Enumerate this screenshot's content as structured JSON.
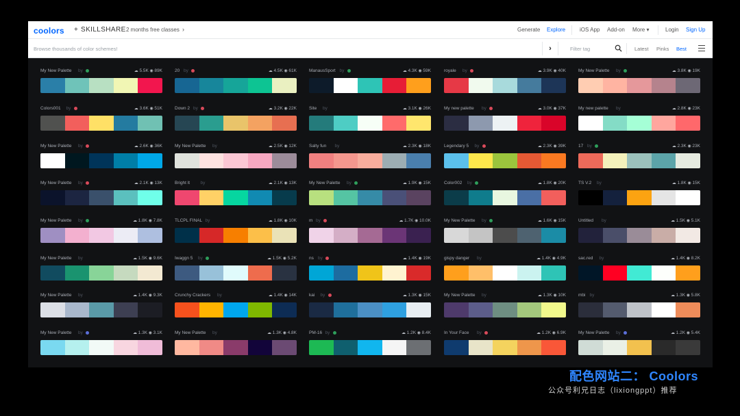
{
  "header": {
    "logo": "coolors",
    "plus": "+",
    "partner": "SKILLSHARE",
    "promo": "2 months free classes",
    "promo_arrow": "›",
    "nav": [
      "Generate",
      "Explore",
      "iOS App",
      "Add-on",
      "More ▾",
      "Login",
      "Sign Up"
    ],
    "active_nav": "Explore"
  },
  "subheader": {
    "browse_placeholder": "Browse thousands of color schemes!",
    "next_arrow": "›",
    "filter_placeholder": "Filter tag",
    "sort": [
      "Latest",
      "Pinks",
      "Best"
    ],
    "active_sort": "Best"
  },
  "palettes": [
    {
      "name": "My New Palette",
      "by": "by",
      "dot": "#2e9e5b",
      "downloads": "5.5K",
      "views": "89K",
      "colors": [
        "#2a7fa8",
        "#6fc3b9",
        "#b8e0c2",
        "#f1f6b4",
        "#f2164e"
      ]
    },
    {
      "name": "20",
      "by": "by",
      "dot": "#d94a5a",
      "downloads": "4.5K",
      "views": "61K",
      "colors": [
        "#176693",
        "#17869b",
        "#16a599",
        "#0dc493",
        "#eaf0c1"
      ]
    },
    {
      "name": "ManausSport",
      "by": "by",
      "dot": "#2e9e5b",
      "downloads": "4.3K",
      "views": "59K",
      "colors": [
        "#0d1b2a",
        "#ffffff",
        "#2ec4b6",
        "#e71d36",
        "#ff9f1c"
      ]
    },
    {
      "name": "royale",
      "by": "by",
      "dot": "#d94a5a",
      "downloads": "3.9K",
      "views": "40K",
      "colors": [
        "#e63946",
        "#f1faee",
        "#a8dadc",
        "#457b9d",
        "#1d3557"
      ]
    },
    {
      "name": "My New Palette",
      "by": "by",
      "dot": "#2e9e5b",
      "downloads": "3.8K",
      "views": "19K",
      "colors": [
        "#ffcdb2",
        "#ffb4a2",
        "#e5989b",
        "#b5838d",
        "#6d6875"
      ]
    },
    {
      "name": "Colors001",
      "by": "by",
      "dot": "#d94a5a",
      "downloads": "3.6K",
      "views": "51K",
      "colors": [
        "#50514f",
        "#f25f5c",
        "#ffe066",
        "#247ba0",
        "#70c1b3"
      ]
    },
    {
      "name": "Down 2",
      "by": "by",
      "dot": "#d94a5a",
      "downloads": "3.2K",
      "views": "22K",
      "colors": [
        "#264653",
        "#2a9d8f",
        "#e9c46a",
        "#f4a261",
        "#e76f51"
      ]
    },
    {
      "name": "Site",
      "by": "by",
      "dot": "",
      "downloads": "3.1K",
      "views": "26K",
      "colors": [
        "#247b7b",
        "#4ecdc4",
        "#f7fff7",
        "#ff6b6b",
        "#ffe66d"
      ]
    },
    {
      "name": "My new palette",
      "by": "by",
      "dot": "#d94a5a",
      "downloads": "3.0K",
      "views": "37K",
      "colors": [
        "#2b2d42",
        "#8d99ae",
        "#edf2f4",
        "#ef233c",
        "#d90429"
      ]
    },
    {
      "name": "My new palette",
      "by": "by",
      "dot": "",
      "downloads": "2.8K",
      "views": "23K",
      "colors": [
        "#ffffff",
        "#84dcc6",
        "#a5ffd6",
        "#ffa69e",
        "#ff686b"
      ]
    },
    {
      "name": "My New Palette",
      "by": "by",
      "dot": "#d94a5a",
      "downloads": "2.6K",
      "views": "36K",
      "colors": [
        "#ffffff",
        "#00171f",
        "#003459",
        "#007ea7",
        "#00a8e8"
      ]
    },
    {
      "name": "My New Palette",
      "by": "by",
      "dot": "",
      "downloads": "2.5K",
      "views": "12K",
      "colors": [
        "#dfe2dc",
        "#fde2e0",
        "#fbc7d4",
        "#f7a8c1",
        "#9c8c9a"
      ]
    },
    {
      "name": "Salty fun",
      "by": "by",
      "dot": "",
      "downloads": "2.3K",
      "views": "18K",
      "colors": [
        "#f08080",
        "#f4978e",
        "#f8ad9d",
        "#9cadb3",
        "#4a7fad"
      ]
    },
    {
      "name": "Legendary 5",
      "by": "by",
      "dot": "#d94a5a",
      "downloads": "2.3K",
      "views": "39K",
      "colors": [
        "#5bc0eb",
        "#fde74c",
        "#9bc53d",
        "#e55934",
        "#fa7921"
      ]
    },
    {
      "name": "17",
      "by": "by",
      "dot": "#2e9e5b",
      "downloads": "2.3K",
      "views": "23K",
      "colors": [
        "#ed6a5a",
        "#f4f1bb",
        "#9bc1bc",
        "#5ca4a9",
        "#e6ebe0"
      ]
    },
    {
      "name": "My New Palette",
      "by": "by",
      "dot": "#d94a5a",
      "downloads": "2.1K",
      "views": "13K",
      "colors": [
        "#0b132b",
        "#1c2541",
        "#3a506b",
        "#5bc0be",
        "#6fffe9"
      ]
    },
    {
      "name": "Bright lt",
      "by": "by",
      "dot": "",
      "downloads": "2.1K",
      "views": "13K",
      "colors": [
        "#ef476f",
        "#ffd166",
        "#06d6a0",
        "#118ab2",
        "#073b4c"
      ]
    },
    {
      "name": "My New Palette",
      "by": "by",
      "dot": "#2e9e5b",
      "downloads": "1.9K",
      "views": "15K",
      "colors": [
        "#b8e07f",
        "#55c4a3",
        "#368ba7",
        "#4a5078",
        "#5a4360"
      ]
    },
    {
      "name": "Color002",
      "by": "by",
      "dot": "#2e9e5b",
      "downloads": "1.8K",
      "views": "20K",
      "colors": [
        "#0b3c49",
        "#0f7c8c",
        "#e8f7e0",
        "#4a6fa5",
        "#f25f5c"
      ]
    },
    {
      "name": "TS V.2",
      "by": "by",
      "dot": "",
      "downloads": "1.8K",
      "views": "15K",
      "colors": [
        "#000000",
        "#14213d",
        "#fca311",
        "#e5e5e5",
        "#ffffff"
      ]
    },
    {
      "name": "My New Palette",
      "by": "by",
      "dot": "#2e9e5b",
      "downloads": "1.8K",
      "views": "7.8K",
      "colors": [
        "#9f8fc2",
        "#f3b0cf",
        "#f2c8e3",
        "#ececf5",
        "#aebfe0"
      ]
    },
    {
      "name": "TLCPL FINAL",
      "by": "by",
      "dot": "",
      "downloads": "1.8K",
      "views": "10K",
      "colors": [
        "#003049",
        "#d62828",
        "#f77f00",
        "#fcbf49",
        "#eae2b7"
      ]
    },
    {
      "name": "m",
      "by": "by",
      "dot": "#d94a5a",
      "downloads": "1.7K",
      "views": "10.0K",
      "colors": [
        "#f0d3e8",
        "#d4aec6",
        "#a56a94",
        "#6b3576",
        "#3a2150"
      ]
    },
    {
      "name": "My New Palette",
      "by": "by",
      "dot": "#2e9e5b",
      "downloads": "1.6K",
      "views": "15K",
      "colors": [
        "#d8d8d8",
        "#c4c4c4",
        "#4c4c4c",
        "#4e6270",
        "#1b8ca6"
      ]
    },
    {
      "name": "Untitled",
      "by": "by",
      "dot": "",
      "downloads": "1.5K",
      "views": "5.1K",
      "colors": [
        "#22223b",
        "#4a4e69",
        "#9a8c98",
        "#c9ada7",
        "#f2e9e4"
      ]
    },
    {
      "name": "My New Palette",
      "by": "by",
      "dot": "",
      "downloads": "1.5K",
      "views": "9.6K",
      "colors": [
        "#114b5f",
        "#1a936f",
        "#88d498",
        "#c6dabf",
        "#f3e9d2"
      ]
    },
    {
      "name": "Iwaggn 5",
      "by": "by",
      "dot": "#2e9e5b",
      "downloads": "1.5K",
      "views": "5.2K",
      "colors": [
        "#3d5a80",
        "#98c1d9",
        "#e0fbfc",
        "#ee6c4d",
        "#293241"
      ]
    },
    {
      "name": "ns",
      "by": "by",
      "dot": "#d94a5a",
      "downloads": "1.4K",
      "views": "19K",
      "colors": [
        "#00a6d6",
        "#1d6ca0",
        "#f0c419",
        "#fff3d0",
        "#d92a2a"
      ]
    },
    {
      "name": "gispy danger",
      "by": "by",
      "dot": "",
      "downloads": "1.4K",
      "views": "4.9K",
      "colors": [
        "#ff9f1c",
        "#ffbf69",
        "#ffffff",
        "#cbf3f0",
        "#2ec4b6"
      ]
    },
    {
      "name": "sac.red",
      "by": "by",
      "dot": "",
      "downloads": "1.4K",
      "views": "8.2K",
      "colors": [
        "#011627",
        "#ff0022",
        "#41ead4",
        "#fdfffc",
        "#ff9f1c"
      ]
    },
    {
      "name": "My New Palette",
      "by": "by",
      "dot": "",
      "downloads": "1.4K",
      "views": "9.3K",
      "colors": [
        "#dcdfe6",
        "#a9b8cc",
        "#5a9aa8",
        "#3d3f52",
        "#1c1d24"
      ]
    },
    {
      "name": "Crunchy Crackers",
      "by": "by",
      "dot": "",
      "downloads": "1.4K",
      "views": "14K",
      "colors": [
        "#f6511d",
        "#ffb400",
        "#00a6ed",
        "#7fb800",
        "#0d2c54"
      ]
    },
    {
      "name": "kai",
      "by": "by",
      "dot": "#d94a5a",
      "downloads": "1.3K",
      "views": "15K",
      "colors": [
        "#1a2a44",
        "#1f6f9c",
        "#4b8fc4",
        "#2fa0e0",
        "#e8eef2"
      ]
    },
    {
      "name": "My New Palette",
      "by": "by",
      "dot": "",
      "downloads": "1.3K",
      "views": "10K",
      "colors": [
        "#4e3a6b",
        "#5c5d8a",
        "#6e8e82",
        "#a4c87d",
        "#f2f98c"
      ]
    },
    {
      "name": "mbi",
      "by": "by",
      "dot": "",
      "downloads": "1.3K",
      "views": "5.8K",
      "colors": [
        "#2b2e3b",
        "#545b6e",
        "#bfc3c9",
        "#ffffff",
        "#ee8c5a"
      ]
    },
    {
      "name": "My New Palette",
      "by": "by",
      "dot": "#5b6fd9",
      "downloads": "1.3K",
      "views": "3.1K",
      "colors": [
        "#7ad9f0",
        "#b5f0ee",
        "#f2faf7",
        "#f8d6e0",
        "#f0bcd8"
      ]
    },
    {
      "name": "My New Palette",
      "by": "by",
      "dot": "",
      "downloads": "1.3K",
      "views": "4.8K",
      "colors": [
        "#ffb8a0",
        "#f08a86",
        "#8a3b6a",
        "#12043a",
        "#6b4a73"
      ]
    },
    {
      "name": "PM-16",
      "by": "by",
      "dot": "#2e9e5b",
      "downloads": "1.2K",
      "views": "8.4K",
      "colors": [
        "#1db954",
        "#0f5f6e",
        "#11b6ee",
        "#f5f5f5",
        "#6c6f73"
      ]
    },
    {
      "name": "In Your Face",
      "by": "by",
      "dot": "#d94a5a",
      "downloads": "1.2K",
      "views": "6.9K",
      "colors": [
        "#0f3b6e",
        "#e8e4c9",
        "#f4d35e",
        "#ee964b",
        "#f95738"
      ]
    },
    {
      "name": "My New Palette",
      "by": "by",
      "dot": "#5b6fd9",
      "downloads": "1.2K",
      "views": "5.4K",
      "colors": [
        "#d0dcd6",
        "#eaf0e6",
        "#f2c14e",
        "#2a2a2a",
        "#3a3a3a"
      ]
    }
  ],
  "caption": {
    "title": "配色网站二：  Coolors",
    "subtitle": "公众号利兄日志（lixiongppt）推荐"
  }
}
